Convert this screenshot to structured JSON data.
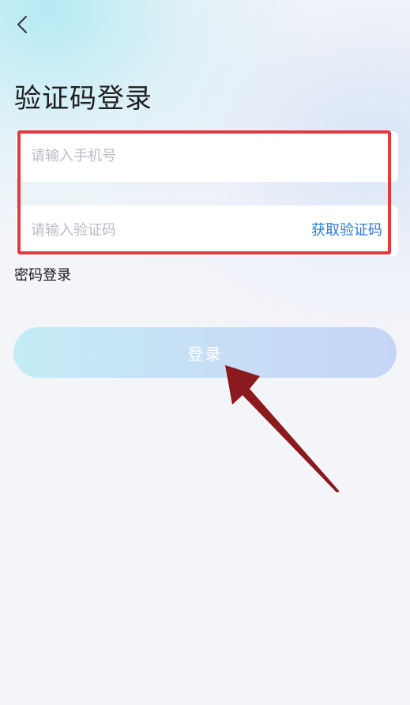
{
  "header": {
    "back_icon": "chevron-left-icon",
    "title": "验证码登录"
  },
  "form": {
    "phone_placeholder": "请输入手机号",
    "code_placeholder": "请输入验证码",
    "get_code_label": "获取验证码",
    "password_login_link": "密码登录",
    "submit_label": "登录"
  },
  "annotations": {
    "highlight_color": "#e0393e",
    "arrow_color": "#8b1a1e"
  },
  "colors": {
    "link": "#2a7bd7",
    "placeholder": "#b9bcc4"
  }
}
